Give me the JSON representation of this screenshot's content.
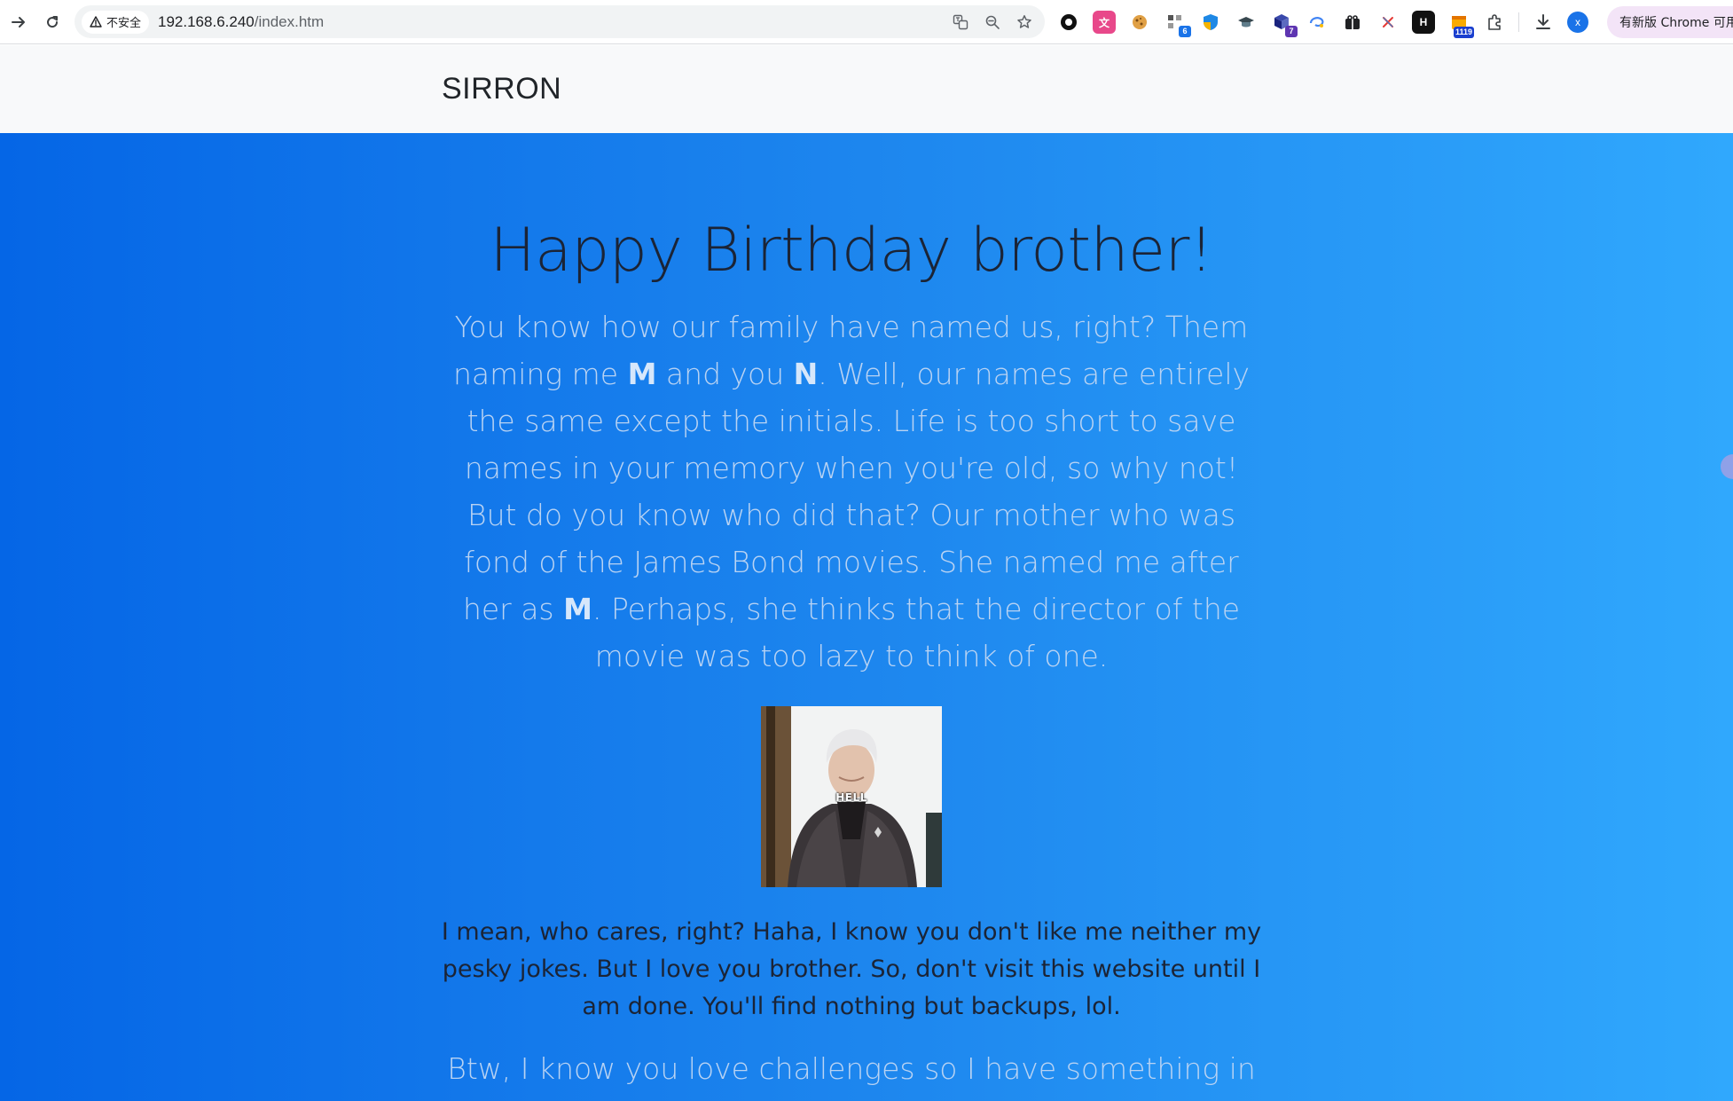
{
  "browser": {
    "back_icon": "arrow-right-icon",
    "reload_icon": "reload-icon",
    "security_label": "不安全",
    "url_host": "192.168.6.240",
    "url_path": "/index.htm",
    "extension_badges": {
      "ext_4": "6",
      "ext_7": "7",
      "ext_13": "1119"
    },
    "profile_initial": "x",
    "update_label": "有新版 Chrome 可用"
  },
  "navbar": {
    "brand": "SIRRON"
  },
  "hero": {
    "title": "Happy Birthday brother!",
    "lead_parts": {
      "p1": "You know how our family have named us, right? Them naming me ",
      "m1": "M",
      "p2": " and you ",
      "n1": "N",
      "p3": ". Well, our names are entirely the same except the initials. Life is too short to save names in your memory when you're old, so why not! But do you know who did that? Our mother who was fond of the James Bond movies. She named me after her as ",
      "m2": "M",
      "p4": ". Perhaps, she thinks that the director of the movie was too lazy to think of one."
    },
    "gif_caption": "HELL",
    "body_text": "I mean, who cares, right? Haha, I know you don't like me neither my pesky jokes. But I love you brother. So, don't visit this website until I am done. You'll find nothing but backups, lol.",
    "lead_2": "Btw, I know you love challenges so I have something in store for you as well."
  },
  "colors": {
    "gradient_start": "#0566e6",
    "gradient_end": "#30a8fd",
    "lead_text": "#b9d3f3",
    "dark_text": "#1b2436",
    "navbar_bg": "#f8f9fa"
  }
}
